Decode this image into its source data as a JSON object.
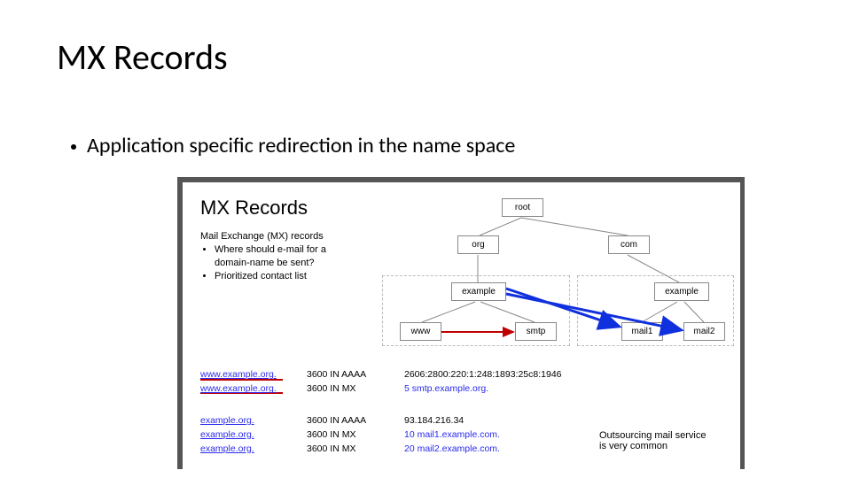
{
  "title": "MX Records",
  "bullet1": "Application specific redirection in the name space",
  "fig": {
    "title": "MX Records",
    "desc_lead": "Mail Exchange (MX) records",
    "desc_b1": "Where should e-mail for a domain-name be sent?",
    "desc_b2": "Prioritized contact list",
    "nodes": {
      "root": "root",
      "org": "org",
      "com": "com",
      "example_org": "example",
      "example_com": "example",
      "www": "www",
      "smtp": "smtp",
      "mail1": "mail1",
      "mail2": "mail2"
    },
    "records1": {
      "l1_name": "www.example.org.",
      "l1_ttl": "3600 IN AAAA",
      "l1_val": "2606:2800:220:1:248:1893:25c8:1946",
      "l2_name": "www.example.org.",
      "l2_ttl": "3600 IN MX",
      "l2_val": "5 smtp.example.org."
    },
    "records2": {
      "l1_name": "example.org.",
      "l1_ttl": "3600 IN AAAA",
      "l1_val": "93.184.216.34",
      "l2_name": "example.org.",
      "l2_ttl": "3600 IN MX",
      "l2_val": "10 mail1.example.com.",
      "l3_name": "example.org.",
      "l3_ttl": "3600 IN MX",
      "l3_val": "20 mail2.example.com."
    },
    "note1": "Outsourcing mail service",
    "note2": "is very common"
  }
}
